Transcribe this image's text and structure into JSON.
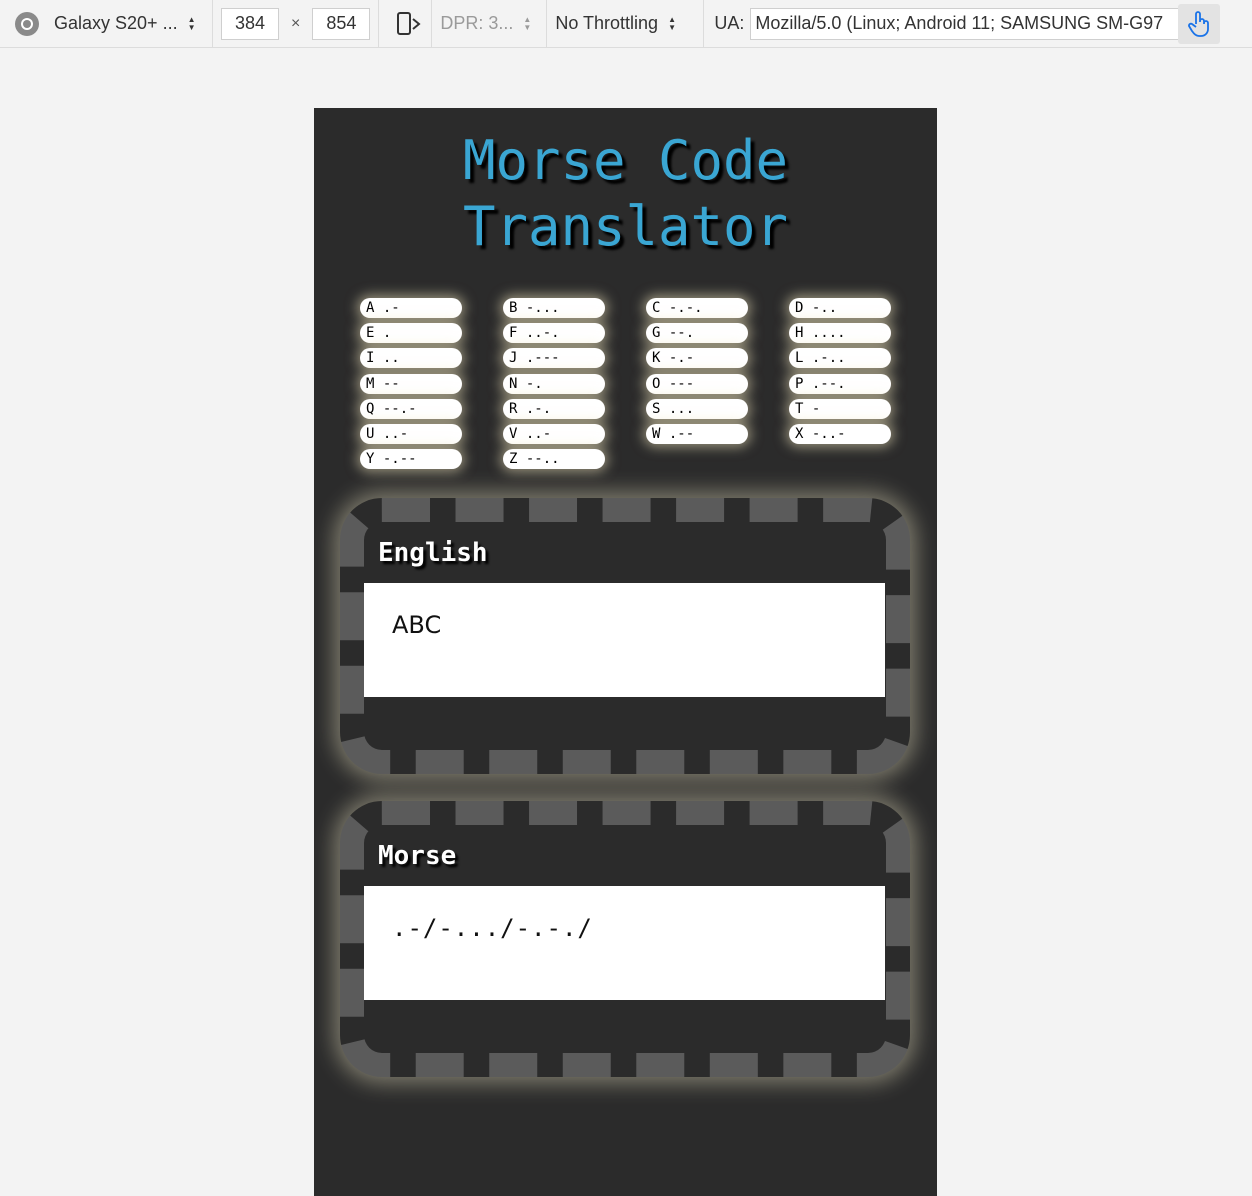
{
  "toolbar": {
    "device": "Galaxy S20+ ...",
    "width": "384",
    "height": "854",
    "times": "×",
    "dpr": "DPR: 3...",
    "throttling": "No Throttling",
    "ua_label": "UA:",
    "ua_value": "Mozilla/5.0 (Linux; Android 11; SAMSUNG SM-G97"
  },
  "page": {
    "title_line1": "Morse Code",
    "title_line2": "Translator",
    "cheatsheet": [
      "A .-",
      "B -...",
      "C -.-.",
      "D -..",
      "E .",
      "F ..-.",
      "G --.",
      "H ....",
      "I ..",
      "J .---",
      "K -.-",
      "L .-..",
      "M --",
      "N -.",
      "O ---",
      "P .--.",
      "Q --.-",
      "R .-.",
      "S ...",
      "T -",
      "U ..-",
      "V ..-",
      "W .--",
      "X -..-",
      "Y -.--",
      "Z --.."
    ],
    "english_label": "English",
    "english_value": "ABC",
    "morse_label": "Morse",
    "morse_value": ".-/-.../-.-./"
  },
  "colors": {
    "accent": "#3aa6d3",
    "viewport_bg": "#2b2b2b",
    "dash": "#5b5b5b"
  }
}
